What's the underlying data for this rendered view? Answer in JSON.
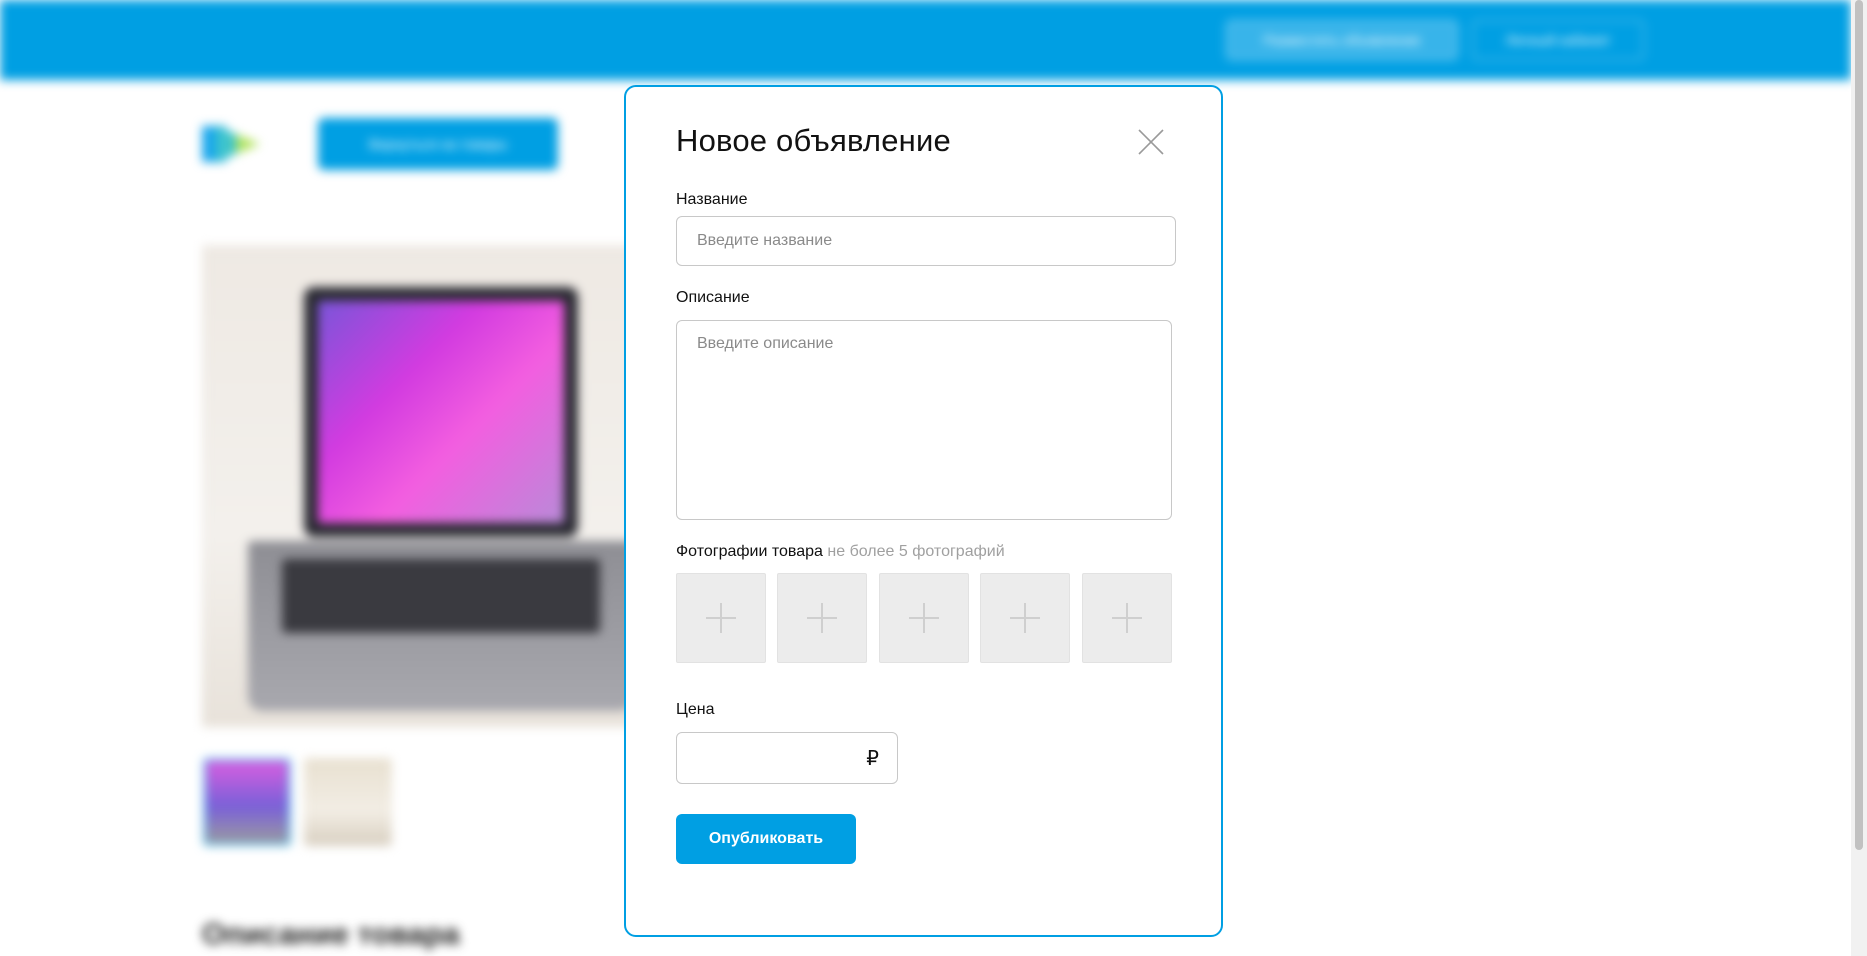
{
  "background": {
    "header": {
      "post_ad_button": "Разместить объявление",
      "account_button": "Личный кабинет"
    },
    "back_button": "Вернуться на товары",
    "section_heading": "Описание товара"
  },
  "modal": {
    "title": "Новое объявление",
    "close_icon": "close-icon",
    "name": {
      "label": "Название",
      "placeholder": "Введите название",
      "value": ""
    },
    "description": {
      "label": "Описание",
      "placeholder": "Введите описание",
      "value": ""
    },
    "photos": {
      "label": "Фотографии товара",
      "hint": "не более 5 фотографий",
      "slot_icon": "plus-icon",
      "slot_count": 5
    },
    "price": {
      "label": "Цена",
      "value": "",
      "currency": "₽"
    },
    "publish_button": "Опубликовать"
  },
  "colors": {
    "accent": "#009fe3",
    "slot_background": "#ececec",
    "hint_text": "#a0a0a0"
  }
}
